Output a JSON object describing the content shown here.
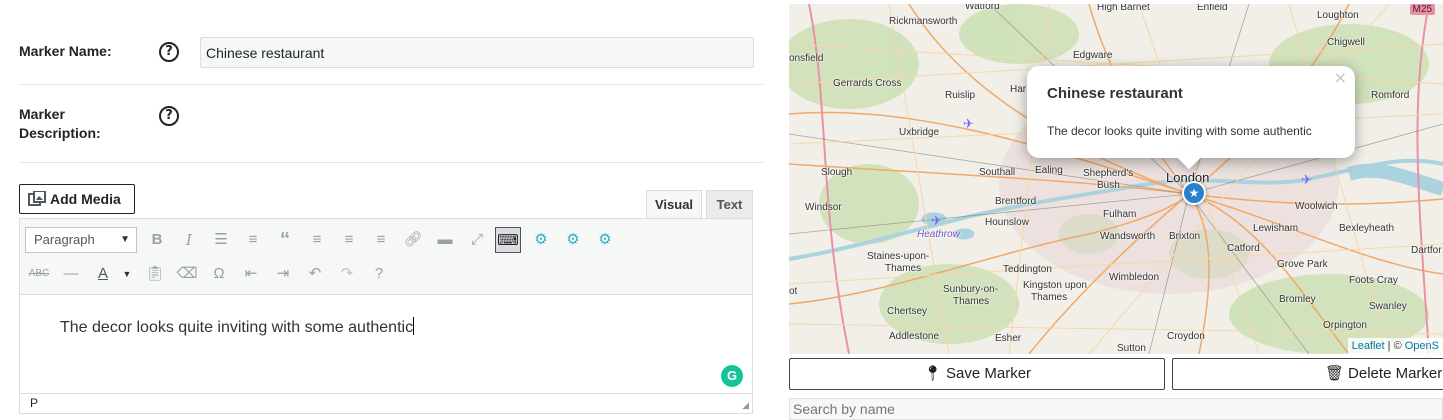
{
  "form": {
    "marker_name_label": "Marker Name:",
    "marker_name_value": "Chinese restaurant",
    "marker_description_label_line1": "Marker",
    "marker_description_label_line2": "Description:",
    "help_glyph": "?"
  },
  "editor": {
    "add_media_label": "Add Media",
    "tabs": {
      "visual": "Visual",
      "text": "Text"
    },
    "format_select": "Paragraph",
    "toolbar_icons_row1": [
      "bold-icon",
      "italic-icon",
      "bullet-list-icon",
      "numbered-list-icon",
      "blockquote-icon",
      "align-left-icon",
      "align-center-icon",
      "align-right-icon",
      "link-icon",
      "read-more-icon",
      "fullscreen-icon",
      "toolbar-toggle-icon",
      "plugin-icon-1",
      "plugin-icon-2",
      "plugin-icon-3"
    ],
    "toolbar_icons_row2": [
      "strikethrough-icon",
      "horizontal-line-icon",
      "text-color-icon",
      "paste-text-icon",
      "clear-formatting-icon",
      "special-character-icon",
      "outdent-icon",
      "indent-icon",
      "undo-icon",
      "redo-icon",
      "help-icon"
    ],
    "content": "The decor looks quite inviting with some authentic",
    "status_path": "P",
    "grammarly_glyph": "G"
  },
  "map": {
    "popup_title": "Chinese restaurant",
    "popup_description": "The decor looks quite inviting with some authentic",
    "popup_close": "×",
    "road_badge": "M25",
    "attribution_leaflet": "Leaflet",
    "attribution_sep": " | © ",
    "attribution_osm": "OpenS",
    "places": {
      "watford": "Watford",
      "high_barnet": "High Barnet",
      "enfield": "Enfield",
      "loughton": "Loughton",
      "rickmansworth": "Rickmansworth",
      "edgware": "Edgware",
      "chigwell": "Chigwell",
      "onsfield": "onsfield",
      "gerrards_cross": "Gerrards Cross",
      "romford": "Romford",
      "ruislip": "Ruislip",
      "har": "Har",
      "uxbridge": "Uxbridge",
      "london": "London",
      "slough": "Slough",
      "southall": "Southall",
      "ealing": "Ealing",
      "shepherds_bush_1": "Shepherd's",
      "shepherds_bush_2": "Bush",
      "windsor": "Windsor",
      "brentford": "Brentford",
      "fulham": "Fulham",
      "woolwich": "Woolwich",
      "heathrow": "Heathrow",
      "hounslow": "Hounslow",
      "wandsworth": "Wandsworth",
      "brixton": "Brixton",
      "lewisham": "Lewisham",
      "bexleyheath": "Bexleyheath",
      "dartford": "Dartfor",
      "staines_1": "Staines-upon-",
      "staines_2": "Thames",
      "teddington": "Teddington",
      "wimbledon": "Wimbledon",
      "catford": "Catford",
      "grove_park": "Grove Park",
      "sunbury_1": "Sunbury-on-",
      "sunbury_2": "Thames",
      "kingston_1": "Kingston upon",
      "kingston_2": "Thames",
      "bromley": "Bromley",
      "foots_cray": "Foots Cray",
      "ot": "ot",
      "chertsey": "Chertsey",
      "swanley": "Swanley",
      "orpington": "Orpington",
      "addlestone": "Addlestone",
      "esher": "Esher",
      "croydon": "Croydon",
      "sutton": "Sutton"
    }
  },
  "actions": {
    "save_marker": "Save Marker",
    "delete_marker": "Delete Marker",
    "search_placeholder": "Search by name"
  }
}
